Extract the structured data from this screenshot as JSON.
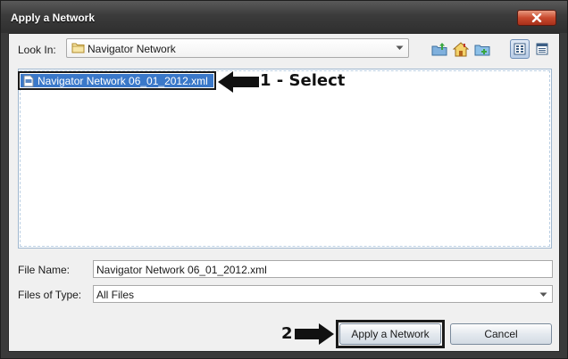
{
  "window": {
    "title": "Apply a Network"
  },
  "look_in": {
    "label": "Look In:",
    "value": "Navigator Network",
    "icon": "folder-icon"
  },
  "toolbar": {
    "icons": [
      "up-one-level-icon",
      "home-icon",
      "new-folder-icon",
      "list-view-icon",
      "details-view-icon"
    ],
    "toggled": "list-view-icon"
  },
  "files": [
    {
      "name": "Navigator Network 06_01_2012.xml",
      "icon": "xml-file-icon",
      "selected": true
    }
  ],
  "annotations": {
    "step1": "1 - Select",
    "step2": "2"
  },
  "form": {
    "file_name_label": "File Name:",
    "file_name_value": "Navigator Network 06_01_2012.xml",
    "file_type_label": "Files of Type:",
    "file_type_value": "All Files"
  },
  "buttons": {
    "apply": "Apply a Network",
    "cancel": "Cancel"
  },
  "colors": {
    "selection": "#3a78c9",
    "title_bar": "#3b3b3b",
    "close_button": "#c94a2e"
  }
}
